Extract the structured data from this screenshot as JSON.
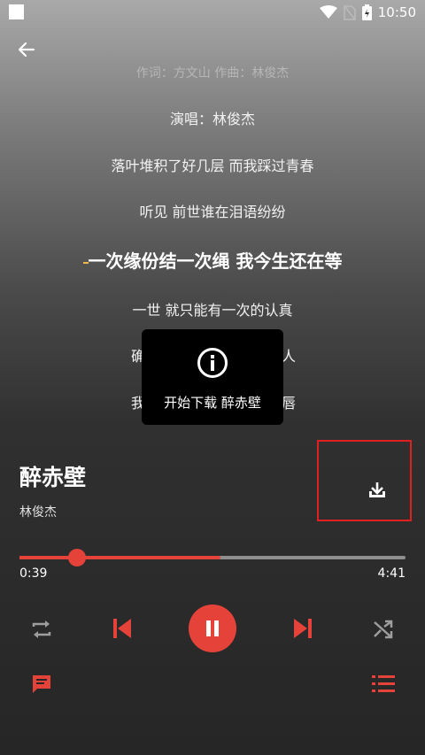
{
  "status": {
    "time": "10:50"
  },
  "song": {
    "title": "醉赤壁",
    "artist": "林俊杰"
  },
  "lyrics": {
    "faded": "作词：方文山  作曲：林俊杰",
    "l1": "演唱：林俊杰",
    "l2": "落叶堆积了好几层 而我踩过青春",
    "l3": "听见 前世谁在泪语纷纷",
    "active": "一次缘份结一次绳 我今生还在等",
    "l5": "一世 就只能有一次的认真",
    "l6": "确",
    "l6b": "人",
    "l7": "我",
    "l7b": "唇"
  },
  "toast": {
    "text": "开始下载 醉赤壁",
    "icon": "info-icon"
  },
  "player": {
    "current_time": "0:39",
    "total_time": "4:41",
    "progress_fraction": 0.15,
    "buffered_fraction": 0.52
  },
  "colors": {
    "accent": "#e5433a",
    "highlight_box": "#e02020"
  }
}
